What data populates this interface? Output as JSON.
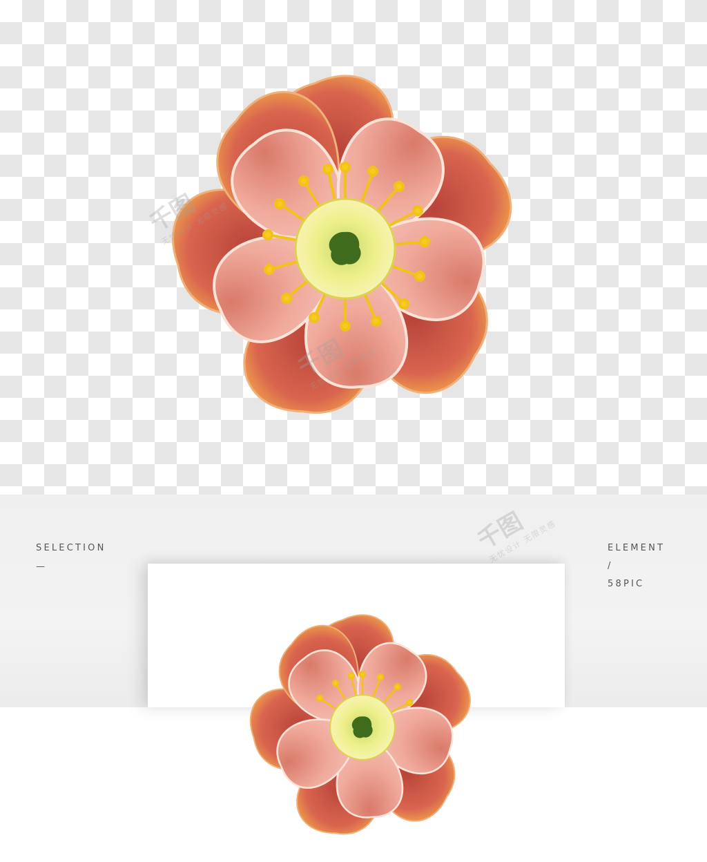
{
  "left_label": {
    "title": "SELECTION",
    "dash": "—"
  },
  "right_label": {
    "title": "ELEMENT",
    "slash": "/",
    "brand": "58PIC"
  },
  "watermark": {
    "main": "千图",
    "sub": "无忧设计 无限灵感"
  },
  "colors": {
    "outer_petal": "#d86a55",
    "inner_petal": "#f2b3a6",
    "center": "#e6ec8a",
    "stamen": "#f2c21b",
    "pistil": "#3f6b1c"
  }
}
